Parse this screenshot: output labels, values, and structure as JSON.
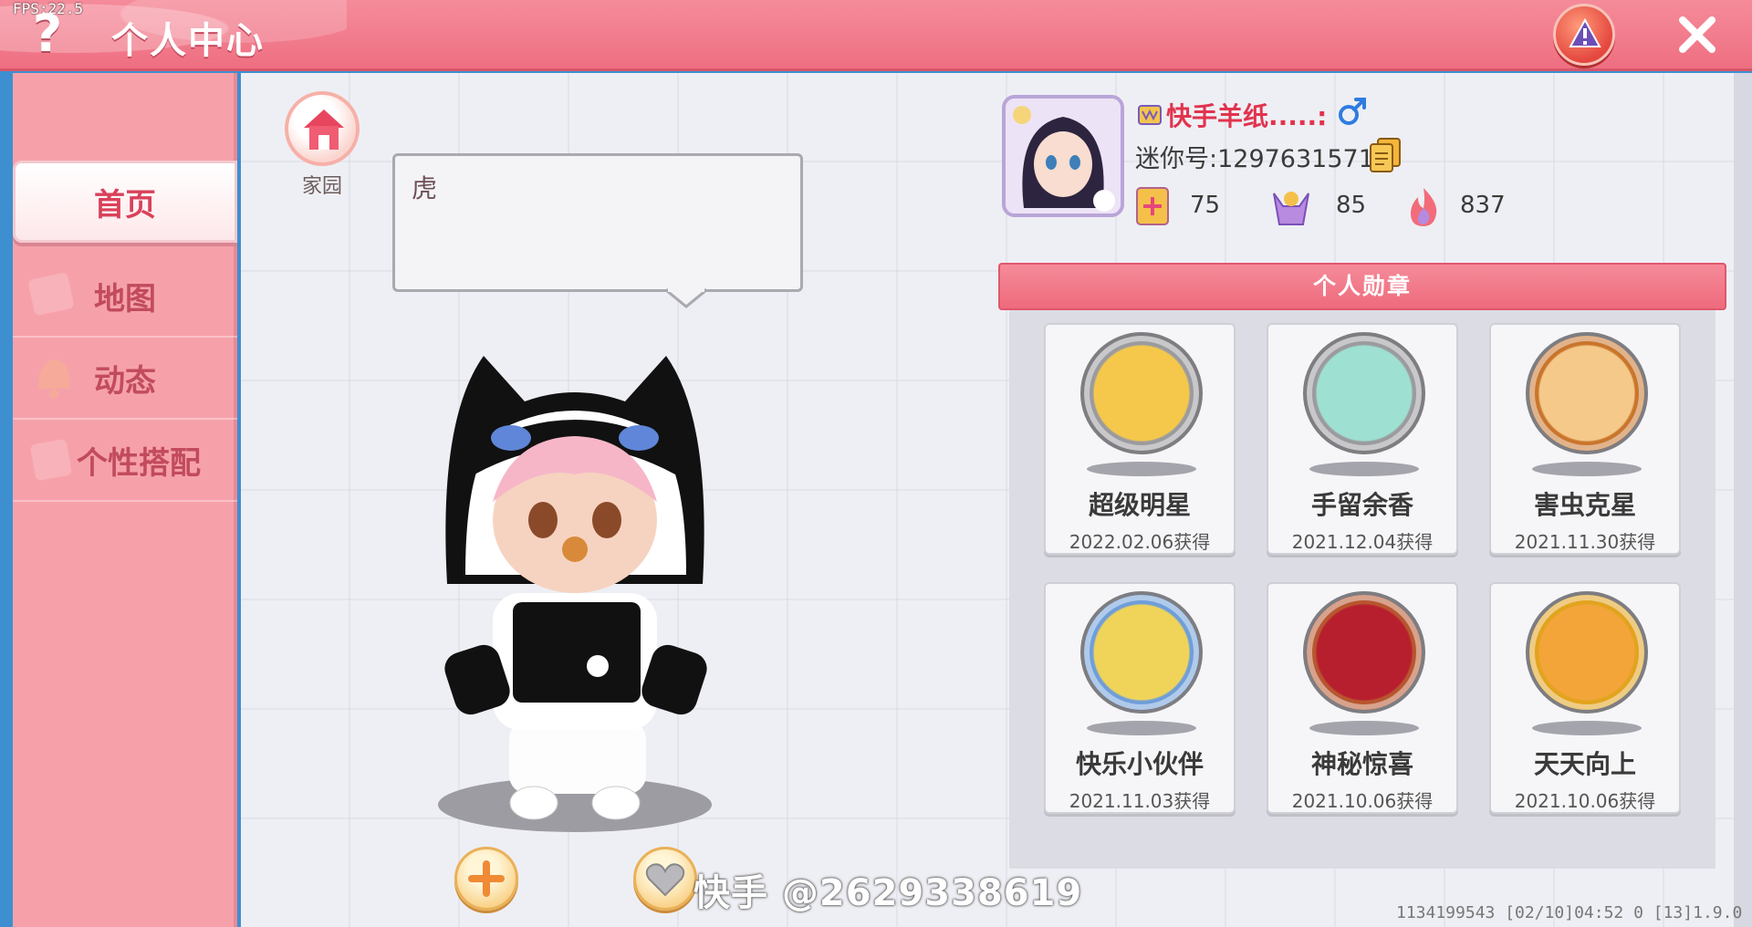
{
  "fps": "FPS:22.5",
  "header": {
    "title": "个人中心"
  },
  "sidebar": {
    "items": [
      {
        "label": "首页",
        "active": true
      },
      {
        "label": "地图",
        "active": false
      },
      {
        "label": "动态",
        "active": false
      },
      {
        "label": "个性搭配",
        "active": false
      }
    ]
  },
  "home": {
    "label": "家园"
  },
  "bubble": {
    "text": "虎"
  },
  "profile": {
    "username": "快手羊纸.....:",
    "gender": "male",
    "mini_id": "迷你号:1297631571",
    "stats": [
      {
        "icon": "plus-card-icon",
        "value": "75"
      },
      {
        "icon": "cheer-icon",
        "value": "85"
      },
      {
        "icon": "flame-icon",
        "value": "837"
      }
    ]
  },
  "medals": {
    "title": "个人勋章",
    "items": [
      {
        "name": "超级明星",
        "date": "2022.02.06获得",
        "ring": "#9b9b9f",
        "fill": "#f5c84c"
      },
      {
        "name": "手留余香",
        "date": "2021.12.04获得",
        "ring": "#9b9b9f",
        "fill": "#9ee0d2"
      },
      {
        "name": "害虫克星",
        "date": "2021.11.30获得",
        "ring": "#c9752c",
        "fill": "#f4c98a"
      },
      {
        "name": "快乐小伙伴",
        "date": "2021.11.03获得",
        "ring": "#6f9ed9",
        "fill": "#f0d45a"
      },
      {
        "name": "神秘惊喜",
        "date": "2021.10.06获得",
        "ring": "#b7562f",
        "fill": "#b81f2e"
      },
      {
        "name": "天天向上",
        "date": "2021.10.06获得",
        "ring": "#e2a31e",
        "fill": "#f3a53a"
      }
    ]
  },
  "watermark": "快手 @2629338619",
  "footer": "1134199543  [02/10]04:52 0  [13]1.9.0",
  "colors": {
    "accent": "#ee6f81",
    "sidebar": "#f6a1aa",
    "name_red": "#e2334e"
  }
}
